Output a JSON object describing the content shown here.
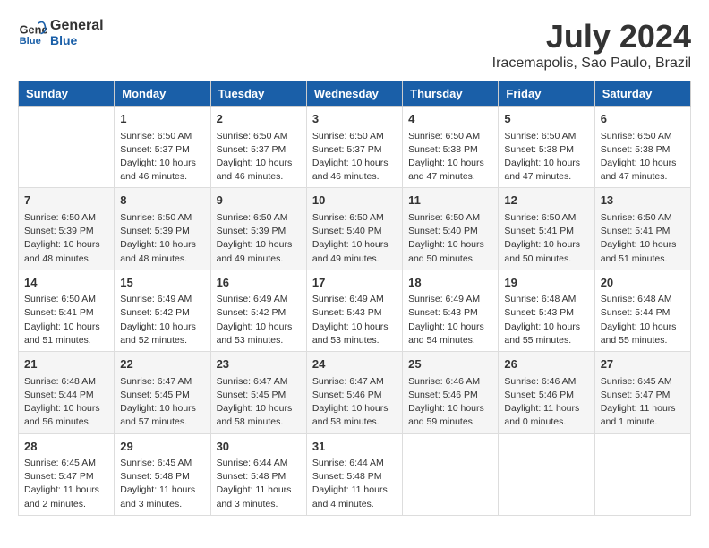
{
  "header": {
    "logo_line1": "General",
    "logo_line2": "Blue",
    "month_year": "July 2024",
    "location": "Iracemapolis, Sao Paulo, Brazil"
  },
  "days_of_week": [
    "Sunday",
    "Monday",
    "Tuesday",
    "Wednesday",
    "Thursday",
    "Friday",
    "Saturday"
  ],
  "weeks": [
    [
      {
        "day": "",
        "info": ""
      },
      {
        "day": "1",
        "info": "Sunrise: 6:50 AM\nSunset: 5:37 PM\nDaylight: 10 hours\nand 46 minutes."
      },
      {
        "day": "2",
        "info": "Sunrise: 6:50 AM\nSunset: 5:37 PM\nDaylight: 10 hours\nand 46 minutes."
      },
      {
        "day": "3",
        "info": "Sunrise: 6:50 AM\nSunset: 5:37 PM\nDaylight: 10 hours\nand 46 minutes."
      },
      {
        "day": "4",
        "info": "Sunrise: 6:50 AM\nSunset: 5:38 PM\nDaylight: 10 hours\nand 47 minutes."
      },
      {
        "day": "5",
        "info": "Sunrise: 6:50 AM\nSunset: 5:38 PM\nDaylight: 10 hours\nand 47 minutes."
      },
      {
        "day": "6",
        "info": "Sunrise: 6:50 AM\nSunset: 5:38 PM\nDaylight: 10 hours\nand 47 minutes."
      }
    ],
    [
      {
        "day": "7",
        "info": "Sunrise: 6:50 AM\nSunset: 5:39 PM\nDaylight: 10 hours\nand 48 minutes."
      },
      {
        "day": "8",
        "info": "Sunrise: 6:50 AM\nSunset: 5:39 PM\nDaylight: 10 hours\nand 48 minutes."
      },
      {
        "day": "9",
        "info": "Sunrise: 6:50 AM\nSunset: 5:39 PM\nDaylight: 10 hours\nand 49 minutes."
      },
      {
        "day": "10",
        "info": "Sunrise: 6:50 AM\nSunset: 5:40 PM\nDaylight: 10 hours\nand 49 minutes."
      },
      {
        "day": "11",
        "info": "Sunrise: 6:50 AM\nSunset: 5:40 PM\nDaylight: 10 hours\nand 50 minutes."
      },
      {
        "day": "12",
        "info": "Sunrise: 6:50 AM\nSunset: 5:41 PM\nDaylight: 10 hours\nand 50 minutes."
      },
      {
        "day": "13",
        "info": "Sunrise: 6:50 AM\nSunset: 5:41 PM\nDaylight: 10 hours\nand 51 minutes."
      }
    ],
    [
      {
        "day": "14",
        "info": "Sunrise: 6:50 AM\nSunset: 5:41 PM\nDaylight: 10 hours\nand 51 minutes."
      },
      {
        "day": "15",
        "info": "Sunrise: 6:49 AM\nSunset: 5:42 PM\nDaylight: 10 hours\nand 52 minutes."
      },
      {
        "day": "16",
        "info": "Sunrise: 6:49 AM\nSunset: 5:42 PM\nDaylight: 10 hours\nand 53 minutes."
      },
      {
        "day": "17",
        "info": "Sunrise: 6:49 AM\nSunset: 5:43 PM\nDaylight: 10 hours\nand 53 minutes."
      },
      {
        "day": "18",
        "info": "Sunrise: 6:49 AM\nSunset: 5:43 PM\nDaylight: 10 hours\nand 54 minutes."
      },
      {
        "day": "19",
        "info": "Sunrise: 6:48 AM\nSunset: 5:43 PM\nDaylight: 10 hours\nand 55 minutes."
      },
      {
        "day": "20",
        "info": "Sunrise: 6:48 AM\nSunset: 5:44 PM\nDaylight: 10 hours\nand 55 minutes."
      }
    ],
    [
      {
        "day": "21",
        "info": "Sunrise: 6:48 AM\nSunset: 5:44 PM\nDaylight: 10 hours\nand 56 minutes."
      },
      {
        "day": "22",
        "info": "Sunrise: 6:47 AM\nSunset: 5:45 PM\nDaylight: 10 hours\nand 57 minutes."
      },
      {
        "day": "23",
        "info": "Sunrise: 6:47 AM\nSunset: 5:45 PM\nDaylight: 10 hours\nand 58 minutes."
      },
      {
        "day": "24",
        "info": "Sunrise: 6:47 AM\nSunset: 5:46 PM\nDaylight: 10 hours\nand 58 minutes."
      },
      {
        "day": "25",
        "info": "Sunrise: 6:46 AM\nSunset: 5:46 PM\nDaylight: 10 hours\nand 59 minutes."
      },
      {
        "day": "26",
        "info": "Sunrise: 6:46 AM\nSunset: 5:46 PM\nDaylight: 11 hours\nand 0 minutes."
      },
      {
        "day": "27",
        "info": "Sunrise: 6:45 AM\nSunset: 5:47 PM\nDaylight: 11 hours\nand 1 minute."
      }
    ],
    [
      {
        "day": "28",
        "info": "Sunrise: 6:45 AM\nSunset: 5:47 PM\nDaylight: 11 hours\nand 2 minutes."
      },
      {
        "day": "29",
        "info": "Sunrise: 6:45 AM\nSunset: 5:48 PM\nDaylight: 11 hours\nand 3 minutes."
      },
      {
        "day": "30",
        "info": "Sunrise: 6:44 AM\nSunset: 5:48 PM\nDaylight: 11 hours\nand 3 minutes."
      },
      {
        "day": "31",
        "info": "Sunrise: 6:44 AM\nSunset: 5:48 PM\nDaylight: 11 hours\nand 4 minutes."
      },
      {
        "day": "",
        "info": ""
      },
      {
        "day": "",
        "info": ""
      },
      {
        "day": "",
        "info": ""
      }
    ]
  ]
}
